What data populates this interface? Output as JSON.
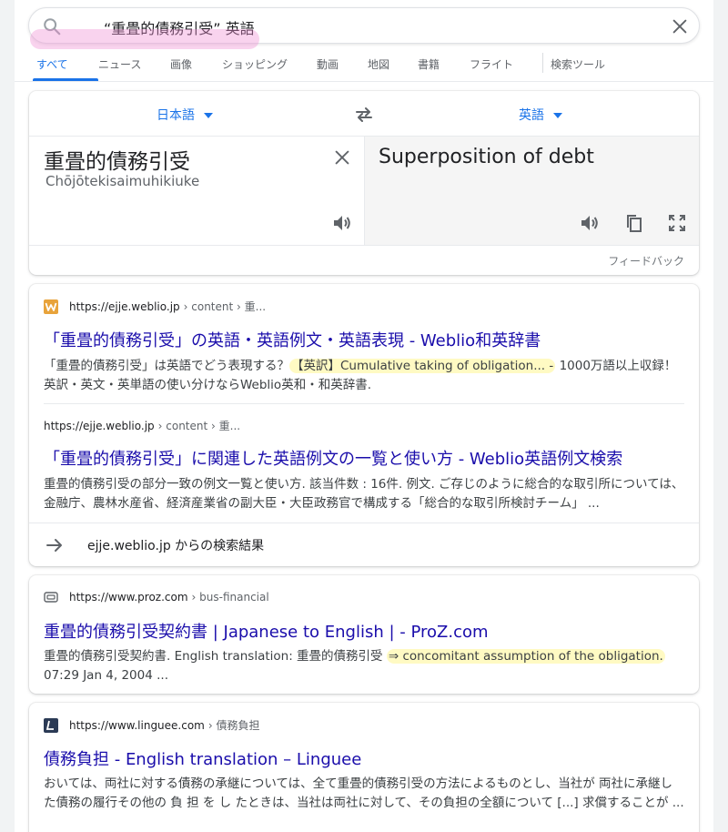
{
  "search": {
    "query": "“重畳的債務引受” 英語"
  },
  "tabs": [
    "すべて",
    "ニュース",
    "画像",
    "ショッピング",
    "動画",
    "地図",
    "書籍",
    "フライト",
    "検索ツール"
  ],
  "translator": {
    "source_lang": "日本語",
    "target_lang": "英語",
    "source_text": "重畳的債務引受",
    "source_romanization": "Chōjōtekisaimuhikiuke",
    "target_text": "Superposition of debt",
    "feedback": "フィードバック"
  },
  "results": [
    {
      "site": "https://ejje.weblio.jp",
      "crumb": "› content › 重...",
      "title": "「重畳的債務引受」の英語・英語例文・英語表現 - Weblio和英辞書",
      "snippet_pre": "「重畳的債務引受」は英語でどう表現する？",
      "snippet_hl": "【英訳】Cumulative taking of obligation... -",
      "snippet_post": " 1000万語以上収録！英訳・英文・英単語の使い分けならWeblio英和・和英辞書.",
      "sub_site": "https://ejje.weblio.jp",
      "sub_crumb": "› content › 重...",
      "sub_title": "「重畳的債務引受」に関連した英語例文の一覧と使い方 - Weblio英語例文検索",
      "sub_snippet": "重畳的債務引受の部分一致の例文一覧と使い方. 該当件数 : 16件. 例文. ご存じのように総合的な取引所については、金融庁、農林水産省、経済産業省の副大臣・大臣政務官で構成する「総合的な取引所検討チーム」 ...",
      "more": "ejje.weblio.jp からの検索結果"
    },
    {
      "site": "https://www.proz.com",
      "crumb": "› bus-financial",
      "title": "重畳的債務引受契約書 | Japanese to English | - ProZ.com",
      "snippet_pre": "重畳的債務引受契約書. English translation: 重畳的債務引受 ",
      "snippet_hl": "⇒ concomitant assumption of the obligation.",
      "snippet_post": " 07:29 Jan 4, 2004 ..."
    },
    {
      "site": "https://www.linguee.com",
      "crumb": "› 債務負担",
      "title": "債務負担 - English translation – Linguee",
      "snippet": "おいては、両社に対する債務の承継については、全て重畳的債務引受の方法によるものとし、当社が 両社に承継した債務の履行その他の 負 担 を し たときは、当社は両社に対して、その負担の全額について [...] 求償することが ..."
    }
  ]
}
